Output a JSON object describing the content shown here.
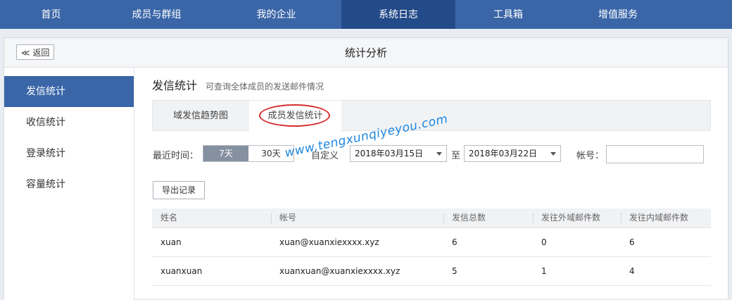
{
  "topnav": {
    "items": [
      "首页",
      "成员与群组",
      "我的企业",
      "系统日志",
      "工具箱",
      "增值服务"
    ],
    "active_index": 3
  },
  "titlebar": {
    "back_label": "≪ 返回",
    "title": "统计分析"
  },
  "sidebar": {
    "items": [
      "发信统计",
      "收信统计",
      "登录统计",
      "容量统计"
    ],
    "active_index": 0
  },
  "section": {
    "title": "发信统计",
    "desc": "可查询全体成员的发送邮件情况"
  },
  "tabs": [
    "域发信趋势图",
    "成员发信统计"
  ],
  "filters": {
    "recent_label": "最近时间：",
    "opt_7": "7天",
    "opt_30": "30天",
    "custom_label": "自定义",
    "start_date": "2018年03月15日",
    "to_label": "至",
    "end_date": "2018年03月22日",
    "account_label": "帐号："
  },
  "export_label": "导出记录",
  "table": {
    "headers": [
      "姓名",
      "帐号",
      "发信总数",
      "发往外域邮件数",
      "发往内域邮件数"
    ],
    "rows": [
      [
        "xuan",
        "xuan@xuanxiexxxx.xyz",
        "6",
        "0",
        "6"
      ],
      [
        "xuanxuan",
        "xuanxuan@xuanxiexxxx.xyz",
        "5",
        "1",
        "4"
      ]
    ]
  },
  "watermark": "www.tengxunqiyeyou.com",
  "colors": {
    "nav_bg": "#3a66a8",
    "nav_active": "#244b89",
    "annotation": "#d62e2e",
    "watermark": "#1e88e0"
  }
}
